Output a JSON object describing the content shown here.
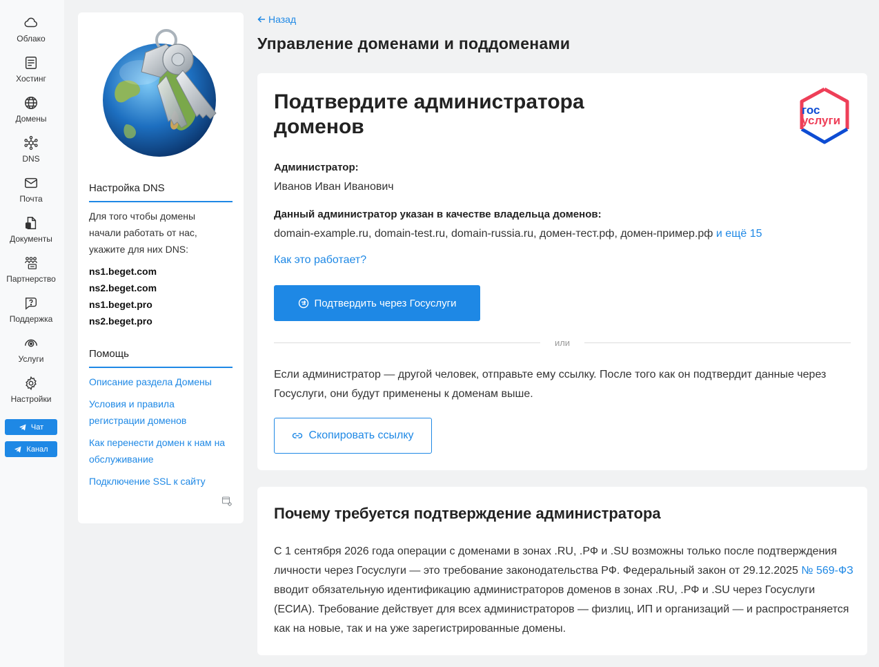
{
  "nav": {
    "items": [
      {
        "label": "Облако",
        "icon": "cloud-icon"
      },
      {
        "label": "Хостинг",
        "icon": "hosting-icon"
      },
      {
        "label": "Домены",
        "icon": "globe-icon"
      },
      {
        "label": "DNS",
        "icon": "dns-icon"
      },
      {
        "label": "Почта",
        "icon": "mail-icon"
      },
      {
        "label": "Документы",
        "icon": "documents-icon"
      },
      {
        "label": "Партнерство",
        "icon": "partners-icon"
      },
      {
        "label": "Поддержка",
        "icon": "support-icon"
      },
      {
        "label": "Услуги",
        "icon": "services-icon"
      },
      {
        "label": "Настройки",
        "icon": "settings-icon"
      }
    ],
    "chat_label": "Чат",
    "channel_label": "Канал"
  },
  "side": {
    "dns_title": "Настройка DNS",
    "dns_text": "Для того чтобы домены начали работать от нас, укажите для них DNS:",
    "ns": [
      "ns1.beget.com",
      "ns2.beget.com",
      "ns1.beget.pro",
      "ns2.beget.pro"
    ],
    "help_title": "Помощь",
    "help_links": [
      "Описание раздела Домены",
      "Условия и правила регистрации доменов",
      "Как перенести домен к нам на обслуживание",
      "Подключение SSL к сайту"
    ]
  },
  "header": {
    "back_label": "Назад",
    "title": "Управление доменами и поддоменами"
  },
  "confirm": {
    "title": "Подтвердите администратора доменов",
    "logo_line1": "гос",
    "logo_line2": "услуги",
    "admin_label": "Администратор:",
    "admin_name": "Иванов Иван Иванович",
    "owner_label": "Данный администратор указан в качестве владельца доменов:",
    "domains": "domain-example.ru, domain-test.ru, domain-russia.ru, домен-тест.рф, домен-пример.рф",
    "more_label": "и ещё 15",
    "how_link": "Как это работает?",
    "gos_button": "Подтвердить через Госуслуги",
    "or_label": "или",
    "other_text": "Если администратор — другой человек, отправьте ему ссылку. После того как он подтвердит данные через Госуслуги, они будут применены к доменам выше.",
    "copy_button": "Скопировать ссылку"
  },
  "why": {
    "title": "Почему требуется подтверждение администратора",
    "text_before": "С 1 сентября 2026 года операции с доменами в зонах .RU, .РФ и .SU возможны только после подтверждения личности через Госуслуги — это требование законодательства РФ. Федеральный закон от 29.12.2025 ",
    "law_link": "№ 569-ФЗ",
    "text_after": " вводит обязательную идентификацию администраторов доменов в зонах .RU, .РФ и .SU через Госуслуги (ЕСИА). Требование действует для всех администраторов — физлиц, ИП и организаций — и распространяется как на новые, так и на уже зарегистрированные домены."
  },
  "colors": {
    "accent": "#1e88e5",
    "gos_red": "#ee3f58",
    "gos_blue": "#0d4cd3"
  }
}
